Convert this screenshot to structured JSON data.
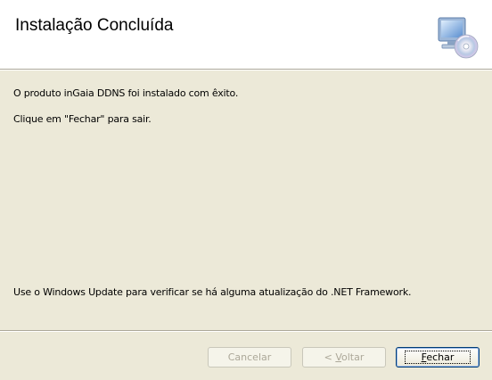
{
  "header": {
    "title": "Instalação Concluída",
    "icon": "computer-cd-icon"
  },
  "body": {
    "line1": "O produto inGaia DDNS foi instalado com êxito.",
    "line2": "Clique em \"Fechar\" para sair.",
    "line3": "Use o Windows Update para verificar se há alguma atualização do .NET Framework."
  },
  "buttons": {
    "cancel": "Cancelar",
    "back_prefix": "< ",
    "back_mnemonic": "V",
    "back_rest": "oltar",
    "close_mnemonic": "F",
    "close_rest": "echar"
  },
  "colors": {
    "dialog_bg": "#ece9d8",
    "header_bg": "#ffffff",
    "button_border": "#003c74",
    "disabled_text": "#aca899"
  }
}
